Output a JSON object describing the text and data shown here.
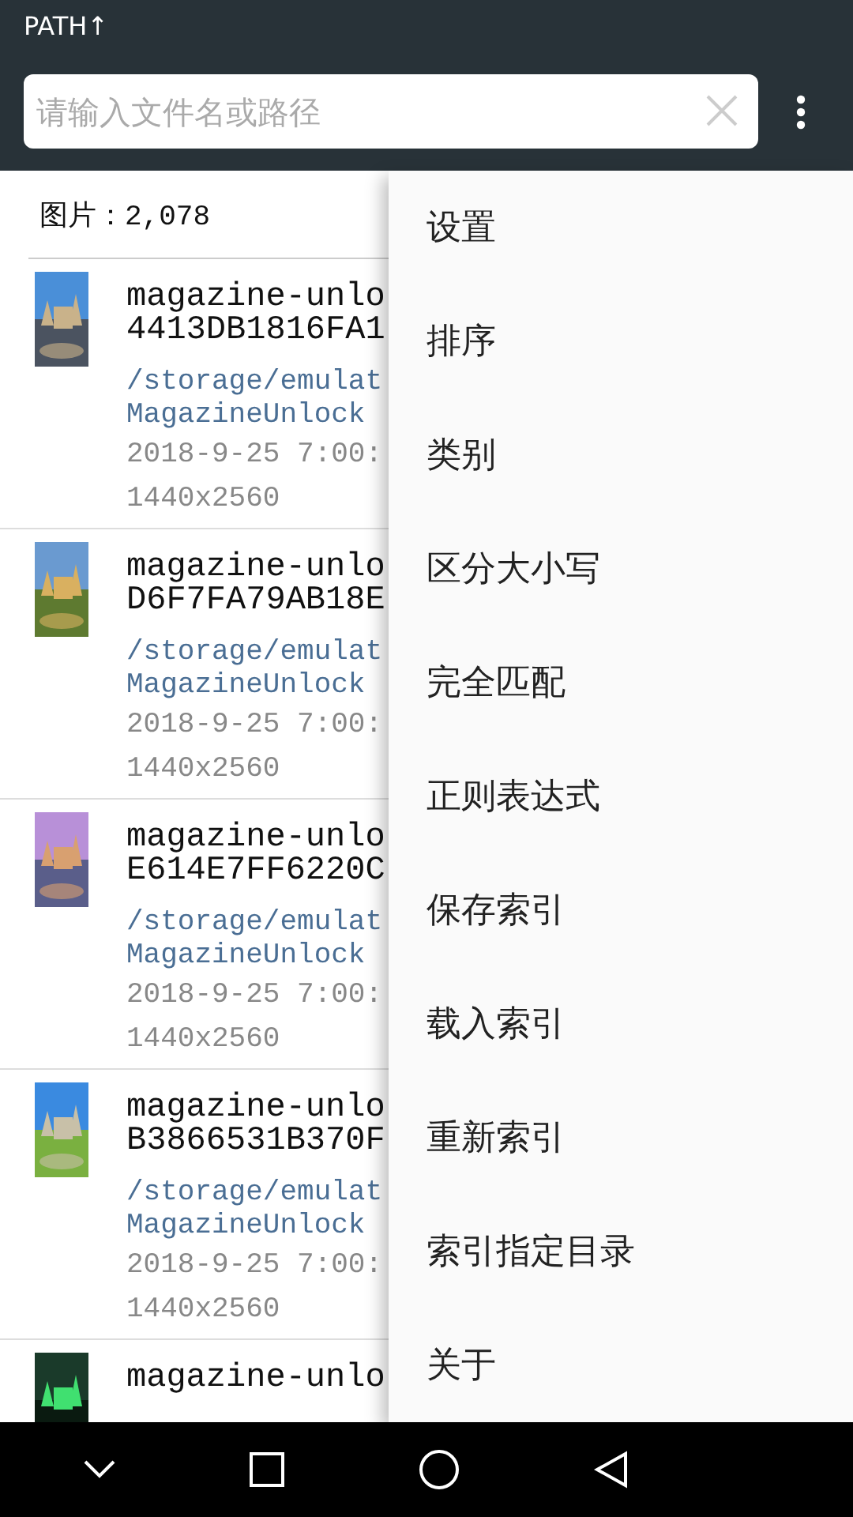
{
  "app_bar": {
    "title": "PATH↑",
    "search": {
      "placeholder": "请输入文件名或路径"
    }
  },
  "count_label": "图片：2,078",
  "files": [
    {
      "name_lines": [
        "magazine-unlo",
        "4413DB1816FA1"
      ],
      "path_lines": [
        "/storage/emulat",
        "MagazineUnlock"
      ],
      "date": "2018-9-25 7:00:",
      "size": "1440x2560",
      "kind": "picture"
    },
    {
      "name_lines": [
        "magazine-unlo",
        "D6F7FA79AB18E"
      ],
      "path_lines": [
        "/storage/emulat",
        "MagazineUnlock"
      ],
      "date": "2018-9-25 7:00:",
      "size": "1440x2560",
      "kind": "picture"
    },
    {
      "name_lines": [
        "magazine-unlo",
        "E614E7FF6220C"
      ],
      "path_lines": [
        "/storage/emulat",
        "MagazineUnlock"
      ],
      "date": "2018-9-25 7:00:",
      "size": "1440x2560",
      "kind": "picture"
    },
    {
      "name_lines": [
        "magazine-unlo",
        "B3866531B370F"
      ],
      "path_lines": [
        "/storage/emulat",
        "MagazineUnlock"
      ],
      "date": "2018-9-25 7:00:",
      "size": "1440x2560",
      "kind": "picture"
    },
    {
      "name_lines": [
        "magazine-unlo"
      ],
      "kind": "picture"
    }
  ],
  "menu": [
    "设置",
    "排序",
    "类别",
    "区分大小写",
    "完全匹配",
    "正则表达式",
    "保存索引",
    "载入索引",
    "重新索引",
    "索引指定目录",
    "关于"
  ]
}
